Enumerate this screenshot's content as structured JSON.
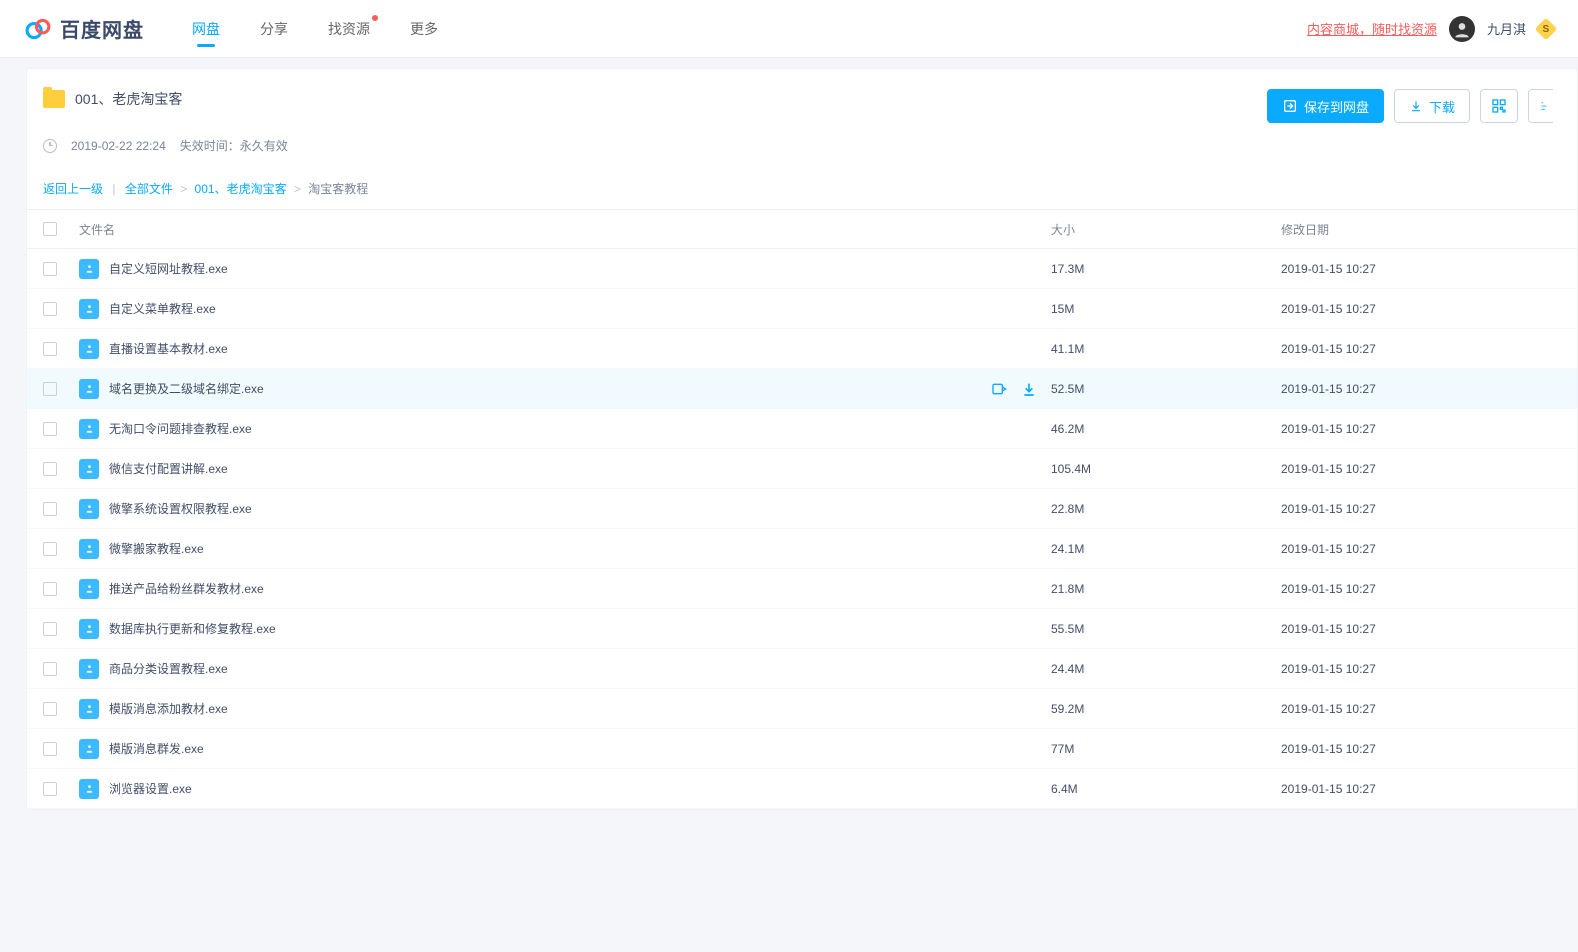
{
  "brand": "百度网盘",
  "nav": {
    "items": [
      {
        "label": "网盘",
        "active": true
      },
      {
        "label": "分享"
      },
      {
        "label": "找资源",
        "dot": true
      },
      {
        "label": "更多"
      }
    ]
  },
  "user": {
    "promo": "内容商城，随时找资源",
    "name": "九月淇",
    "vip": "S"
  },
  "folder": {
    "title": "001、老虎淘宝客",
    "timestamp": "2019-02-22 22:24",
    "expiry_label": "失效时间：永久有效"
  },
  "actions": {
    "save": "保存到网盘",
    "download": "下载"
  },
  "breadcrumb": {
    "back": "返回上一级",
    "root": "全部文件",
    "mid": "001、老虎淘宝客",
    "current": "淘宝客教程"
  },
  "columns": {
    "name": "文件名",
    "size": "大小",
    "date": "修改日期"
  },
  "files": [
    {
      "name": "自定义短网址教程.exe",
      "size": "17.3M",
      "date": "2019-01-15 10:27"
    },
    {
      "name": "自定义菜单教程.exe",
      "size": "15M",
      "date": "2019-01-15 10:27"
    },
    {
      "name": "直播设置基本教材.exe",
      "size": "41.1M",
      "date": "2019-01-15 10:27"
    },
    {
      "name": "域名更换及二级域名绑定.exe",
      "size": "52.5M",
      "date": "2019-01-15 10:27",
      "hovered": true
    },
    {
      "name": "无淘口令问题排查教程.exe",
      "size": "46.2M",
      "date": "2019-01-15 10:27"
    },
    {
      "name": "微信支付配置讲解.exe",
      "size": "105.4M",
      "date": "2019-01-15 10:27"
    },
    {
      "name": "微擎系统设置权限教程.exe",
      "size": "22.8M",
      "date": "2019-01-15 10:27"
    },
    {
      "name": "微擎搬家教程.exe",
      "size": "24.1M",
      "date": "2019-01-15 10:27"
    },
    {
      "name": "推送产品给粉丝群发教材.exe",
      "size": "21.8M",
      "date": "2019-01-15 10:27"
    },
    {
      "name": "数据库执行更新和修复教程.exe",
      "size": "55.5M",
      "date": "2019-01-15 10:27"
    },
    {
      "name": "商品分类设置教程.exe",
      "size": "24.4M",
      "date": "2019-01-15 10:27"
    },
    {
      "name": "模版消息添加教材.exe",
      "size": "59.2M",
      "date": "2019-01-15 10:27"
    },
    {
      "name": "模版消息群发.exe",
      "size": "77M",
      "date": "2019-01-15 10:27"
    },
    {
      "name": "浏览器设置.exe",
      "size": "6.4M",
      "date": "2019-01-15 10:27"
    }
  ]
}
